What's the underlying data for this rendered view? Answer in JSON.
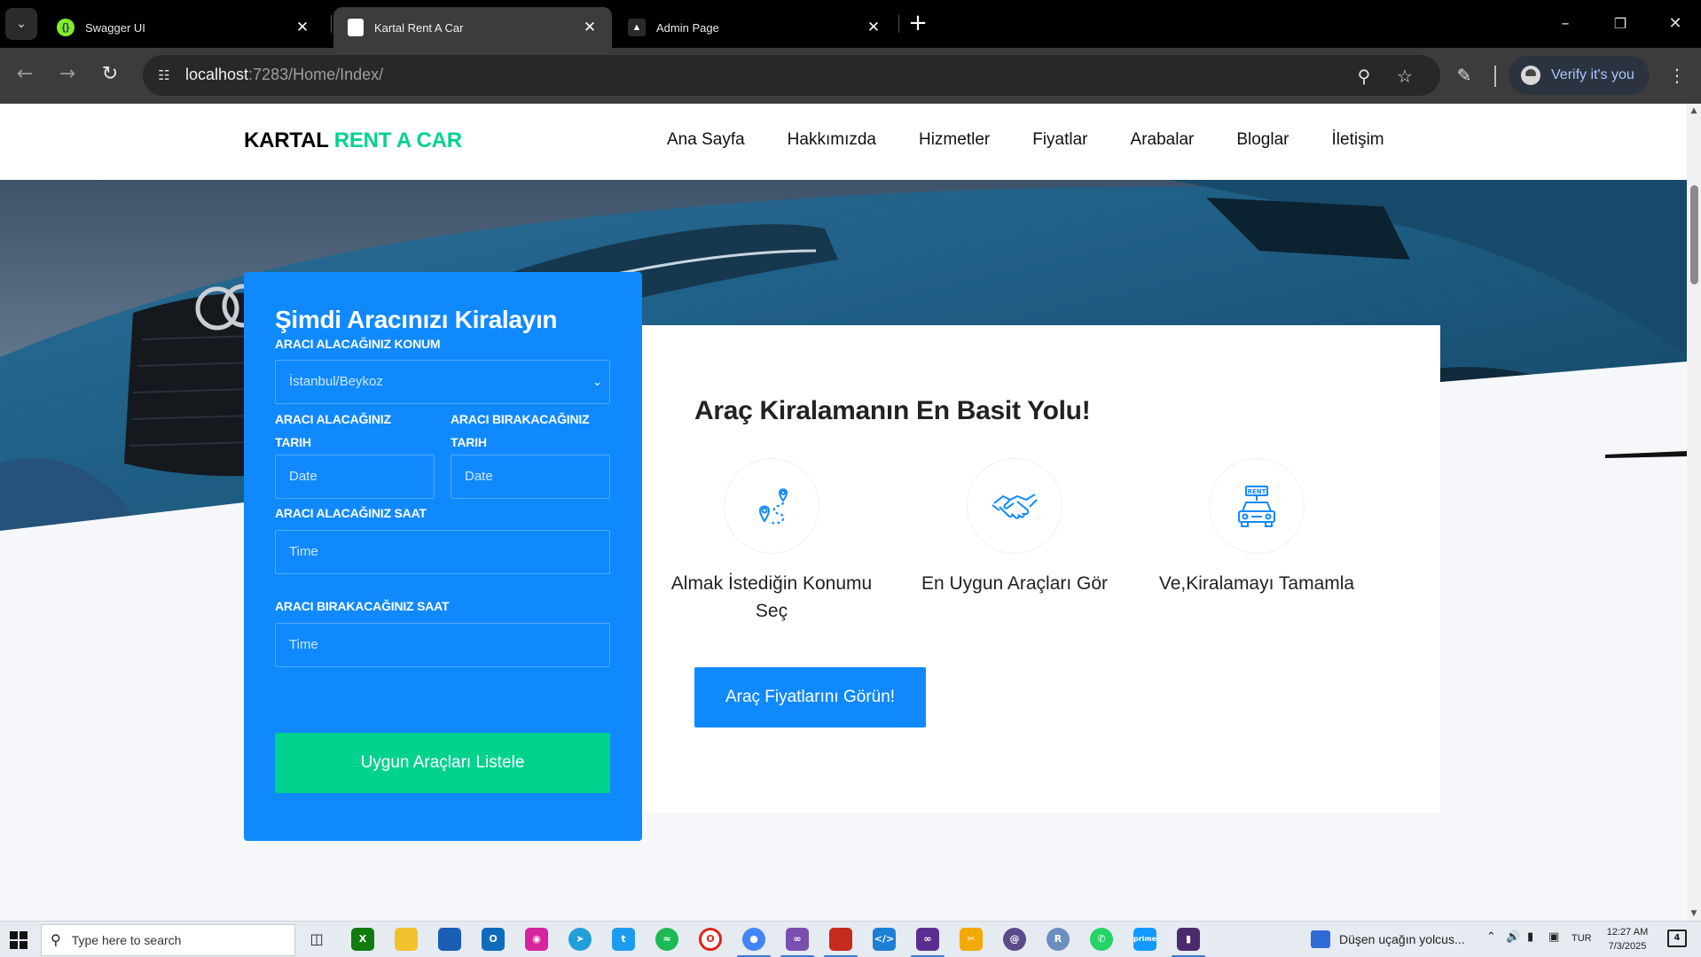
{
  "browser": {
    "tabs": [
      {
        "title": "Swagger UI",
        "active": false
      },
      {
        "title": "Kartal Rent A Car",
        "active": true
      },
      {
        "title": "Admin Page",
        "active": false
      }
    ],
    "url_host": "localhost",
    "url_rest": ":7283/Home/Index/",
    "profile_label": "Verify it's you"
  },
  "site": {
    "logo_part1": "KARTAL",
    "logo_part2": "RENT A CAR",
    "nav": [
      "Ana Sayfa",
      "Hakkımızda",
      "Hizmetler",
      "Fiyatlar",
      "Arabalar",
      "Bloglar",
      "İletişim"
    ]
  },
  "booking": {
    "title": "Şimdi Aracınızı Kiralayın",
    "location_label": "ARACI ALACAĞINIZ KONUM",
    "location_value": "İstanbul/Beykoz",
    "pickup_date_label": "ARACI ALACAĞINIZ TARIH",
    "dropoff_date_label": "ARACI BIRAKACAĞINIZ TARIH",
    "date_placeholder": "Date",
    "pickup_time_label": "ARACI ALACAĞINIZ SAAT",
    "dropoff_time_label": "ARACI BIRAKACAĞINIZ SAAT",
    "time_placeholder": "Time",
    "submit_label": "Uygun Araçları Listele"
  },
  "steps": {
    "title": "Araç Kiralamanın En Basit Yolu!",
    "items": [
      {
        "caption": "Almak İstediğin Konumu Seç",
        "icon": "location-route-icon"
      },
      {
        "caption": "En Uygun Araçları Gör",
        "icon": "handshake-icon"
      },
      {
        "caption": "Ve,Kiralamayı Tamamla",
        "icon": "rent-car-icon"
      }
    ],
    "cta_label": "Araç Fiyatlarını Görün!"
  },
  "taskbar": {
    "search_placeholder": "Type here to search",
    "news_text": "Düşen uçağın yolcus...",
    "language": "TUR",
    "time": "12:27 AM",
    "date": "7/3/2025",
    "notification_count": "4"
  },
  "colors": {
    "brand_green": "#01d28e",
    "brand_blue": "#1089ff"
  }
}
